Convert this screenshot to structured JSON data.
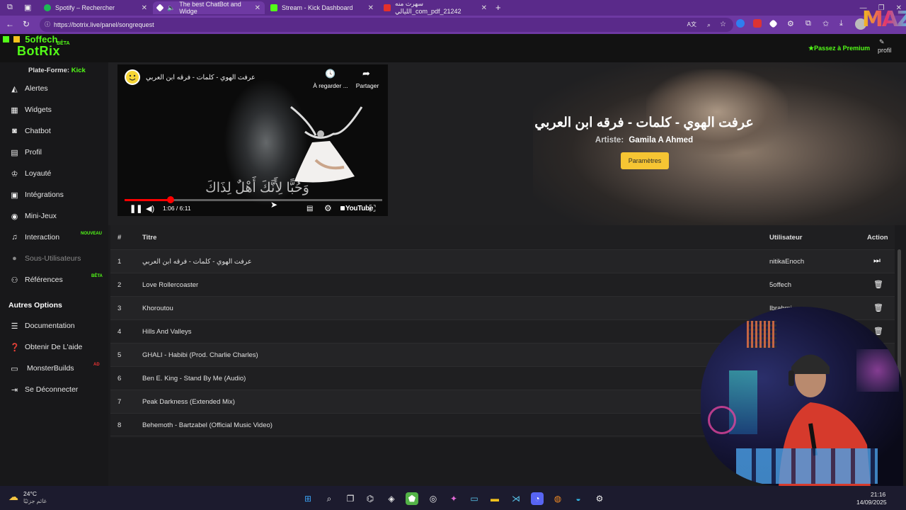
{
  "browser": {
    "tabs": [
      {
        "label": "Spotify – Rechercher",
        "color": "#1db954"
      },
      {
        "label": "The best ChatBot and Widge",
        "color": "#ffffff"
      },
      {
        "label": "Stream - Kick Dashboard",
        "color": "#53fc18"
      },
      {
        "label": "سهرت منه الليالي_com_pdf_21242",
        "color": "#e4312b"
      }
    ],
    "url": "https://botrix.live/panel/songrequest"
  },
  "header": {
    "brand_top": "5offech",
    "brand": "BotRix",
    "beta": "BÊTA",
    "premium": "Passez à Premium",
    "profile": "profil"
  },
  "sidebar": {
    "platform_label": "Plate-Forme:",
    "platform_value": "Kick",
    "items": [
      {
        "label": "Alertes",
        "icon": "bell-icon"
      },
      {
        "label": "Widgets",
        "icon": "widgets-icon"
      },
      {
        "label": "Chatbot",
        "icon": "robot-icon"
      },
      {
        "label": "Profil",
        "icon": "id-card-icon"
      },
      {
        "label": "Loyauté",
        "icon": "trophy-icon"
      },
      {
        "label": "Intégrations",
        "icon": "integrations-icon"
      },
      {
        "label": "Mini-Jeux",
        "icon": "gamepad-icon"
      },
      {
        "label": "Interaction",
        "icon": "music-note-icon",
        "badge": "NOUVEAU"
      },
      {
        "label": "Sous-Utilisateurs",
        "icon": "users-icon"
      },
      {
        "label": "Références",
        "icon": "referral-icon",
        "badge": "BÊTA"
      }
    ],
    "other_heading": "Autres Options",
    "other_items": [
      {
        "label": "Documentation",
        "icon": "docs-icon"
      },
      {
        "label": "Obtenir De L'aide",
        "icon": "help-icon"
      },
      {
        "label": "MonsterBuilds",
        "icon": "monitor-icon",
        "badge": "AD"
      },
      {
        "label": "Se Déconnecter",
        "icon": "logout-icon"
      }
    ]
  },
  "player": {
    "video_title": "عرفت الهوي - كلمات - فرقه ابن العربي",
    "watch_later": "À regarder ...",
    "share": "Partager",
    "subtitle": "وَحُبًّا لِأَنَّكَ أَهْلٌ لِذَاكَ",
    "time": "1:06 / 6:11",
    "progress": 0.178,
    "youtube": "YouTube"
  },
  "now_playing": {
    "title": "عرفت الهوي - كلمات - فرقه ابن العربي",
    "artist_label": "Artiste:",
    "artist": "Gamila A Ahmed",
    "settings_button": "Paramètres"
  },
  "queue": {
    "headers": {
      "num": "#",
      "title": "Titre",
      "user": "Utilisateur",
      "action": "Action"
    },
    "rows": [
      {
        "num": "1",
        "title": "عرفت الهوي - كلمات - فرقه ابن العربي",
        "user": "nitikaEnoch",
        "action": "skip"
      },
      {
        "num": "2",
        "title": "Love Rollercoaster",
        "user": "5offech",
        "action": "delete"
      },
      {
        "num": "3",
        "title": "Khoroutou",
        "user": "Ibrahmi...",
        "action": "delete"
      },
      {
        "num": "4",
        "title": "Hills And Valleys",
        "user": "",
        "action": "delete"
      },
      {
        "num": "5",
        "title": "GHALI - Habibi (Prod. Charlie Charles)",
        "user": "",
        "action": ""
      },
      {
        "num": "6",
        "title": "Ben E. King - Stand By Me (Audio)",
        "user": "",
        "action": ""
      },
      {
        "num": "7",
        "title": "Peak Darkness (Extended Mix)",
        "user": "",
        "action": ""
      },
      {
        "num": "8",
        "title": "Behemoth - Bartzabel (Official Music Video)",
        "user": "",
        "action": ""
      }
    ]
  },
  "taskbar": {
    "temp": "24°C",
    "condition": "غائم جزئيًا",
    "time": "21:16",
    "date": "14/09/2025"
  },
  "overlay": {
    "maz": "MAZ"
  }
}
